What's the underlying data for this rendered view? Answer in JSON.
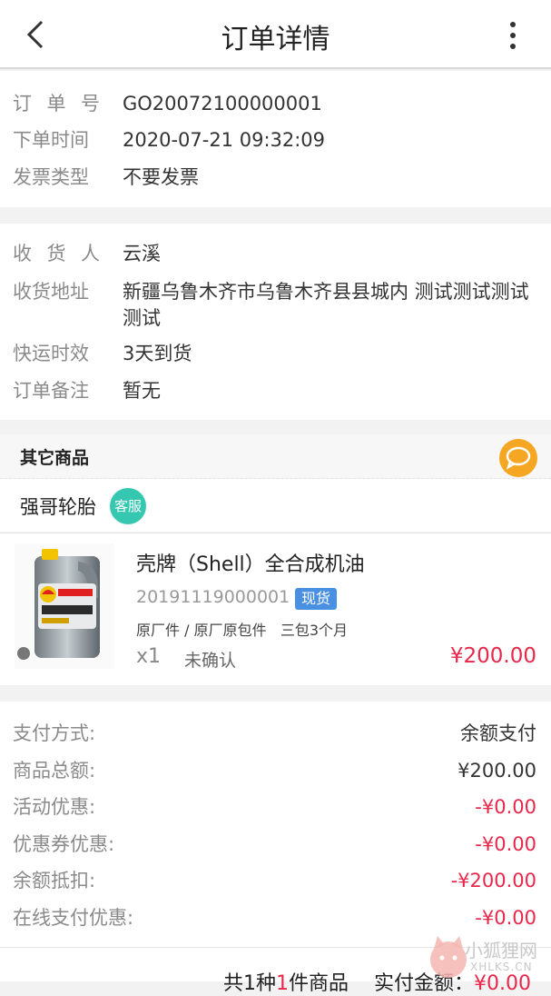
{
  "header": {
    "title": "订单详情"
  },
  "order": {
    "order_no_label": [
      "订",
      "单",
      "号"
    ],
    "order_no": "GO20072100000001",
    "time_label": "下单时间",
    "time": "2020-07-21 09:32:09",
    "invoice_label": "发票类型",
    "invoice": "不要发票"
  },
  "shipping": {
    "receiver_label": [
      "收",
      "货",
      "人"
    ],
    "receiver": "云溪",
    "address_label": "收货地址",
    "address": "新疆乌鲁木齐市乌鲁木齐县县城内 测试测试测试测试",
    "delivery_label": "快运时效",
    "delivery": "3天到货",
    "remark_label": "订单备注",
    "remark": "暂无"
  },
  "goods": {
    "section_title": "其它商品",
    "shop_name": "强哥轮胎",
    "service_tag": "客服",
    "product": {
      "name": "壳牌（Shell）全合成机油",
      "code": "20191119000001",
      "stock_tag": "现货",
      "attrs": "原厂件 / 原厂原包件   三包3个月",
      "qty": "x1",
      "status": "未确认",
      "price": "¥200.00"
    }
  },
  "payment": {
    "rows": [
      {
        "label": "支付方式:",
        "value": "余额支付"
      },
      {
        "label": "商品总额:",
        "value": "¥200.00"
      },
      {
        "label": "活动优惠:",
        "value": "-¥0.00"
      },
      {
        "label": "优惠券优惠:",
        "value": "-¥0.00"
      },
      {
        "label": "余额抵扣:",
        "value": "-¥200.00"
      },
      {
        "label": "在线支付优惠:",
        "value": "-¥0.00"
      }
    ]
  },
  "footer": {
    "summary_prefix": "共1种",
    "summary_count": "1",
    "summary_suffix": "件商品    实付金额：",
    "total": "¥0.00"
  },
  "watermark": {
    "cn": "小狐狸网",
    "en": "XHLKS.CN"
  },
  "colors": {
    "accent_red": "#e8274a",
    "service_green": "#35c7b0",
    "chat_orange": "#f5a623",
    "stock_blue": "#4a90e2"
  }
}
